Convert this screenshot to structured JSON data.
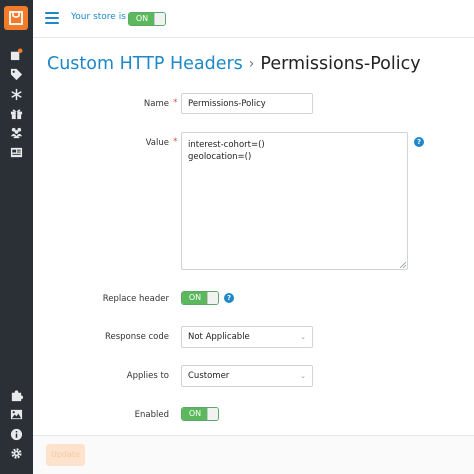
{
  "sidebar": {
    "logo": "store-logo",
    "icons": [
      "add-product-icon",
      "tag-icon",
      "snowflake-icon",
      "gift-icon",
      "users-icon",
      "news-icon"
    ],
    "bottom_icons": [
      "puzzle-icon",
      "image-icon",
      "info-icon",
      "gear-icon"
    ]
  },
  "topbar": {
    "store_label": "Your store is",
    "store_toggle": "ON"
  },
  "breadcrumb": {
    "parent": "Custom HTTP Headers",
    "separator": "›",
    "current": "Permissions-Policy"
  },
  "form": {
    "name_label": "Name",
    "name_value": "Permissions-Policy",
    "value_label": "Value",
    "value_text": "interest-cohort=()\ngeolocation=()",
    "replace_label": "Replace header",
    "replace_toggle": "ON",
    "response_label": "Response code",
    "response_value": "Not Applicable",
    "applies_label": "Applies to",
    "applies_value": "Customer",
    "enabled_label": "Enabled",
    "enabled_toggle": "ON",
    "required_mark": "*",
    "help_mark": "?"
  },
  "footer": {
    "update_label": "Update"
  },
  "colors": {
    "accent": "#1e88c8",
    "toggle_on": "#5cb85c",
    "sidebar": "#2b3036",
    "logo": "#f27b2a",
    "required": "#d9534f"
  }
}
